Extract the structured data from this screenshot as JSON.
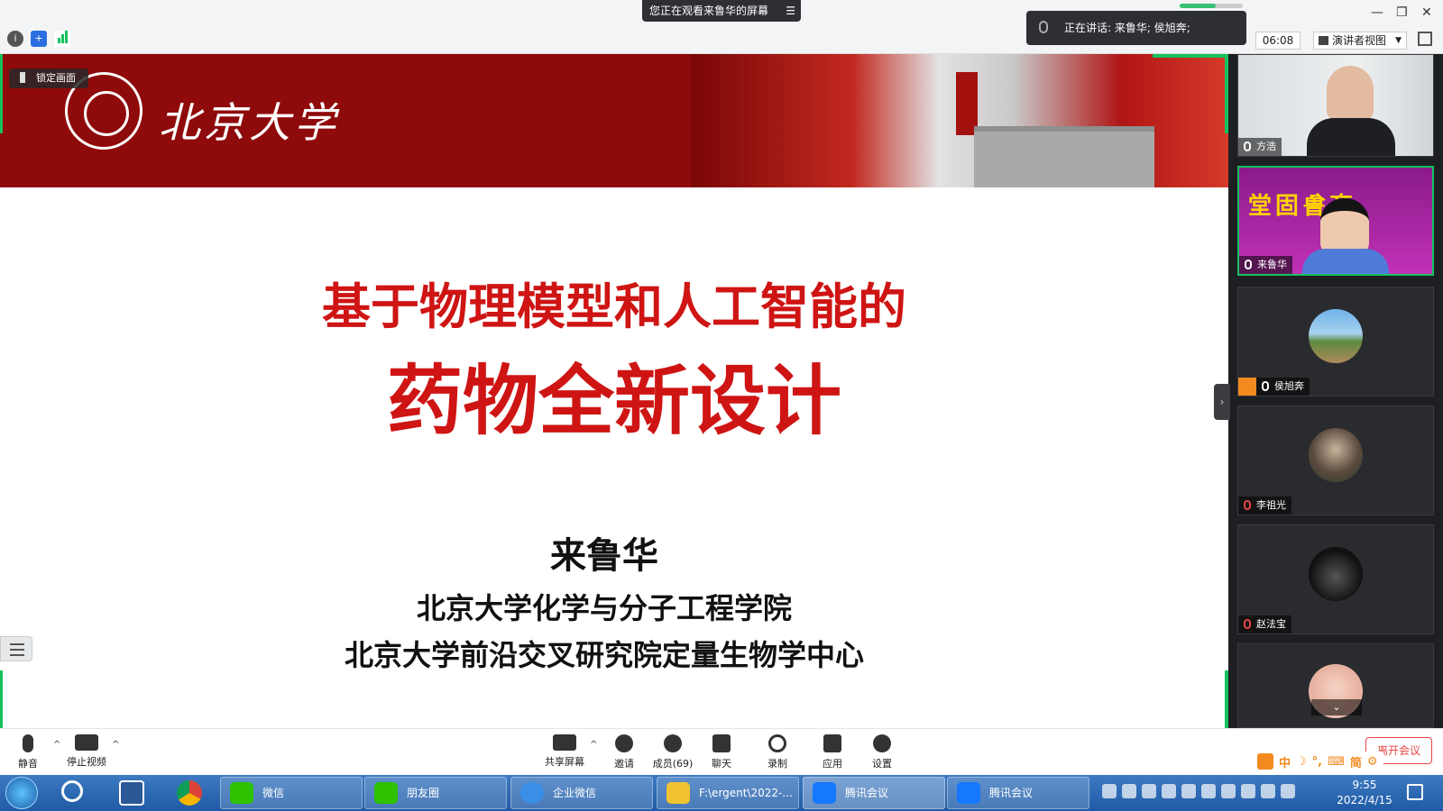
{
  "topbar": {
    "sharing_banner": "您正在观看来鲁华的屏幕",
    "speaking_label": "正在讲话: 来鲁华; 侯旭奔;",
    "timer": "06:08",
    "presenter_view": "演讲者视图",
    "window_minimize": "—",
    "window_restore": "❐",
    "window_close": "✕"
  },
  "slide": {
    "university_name": "北京大学",
    "lock_screen": "锁定画面",
    "title_line1": "基于物理模型和人工智能的",
    "title_line2": "药物全新设计",
    "author": "来鲁华",
    "affiliation_1": "北京大学化学与分子工程学院",
    "affiliation_2": "北京大学前沿交叉研究院定量生物学中心",
    "accent_color": "#cf1414",
    "header_color": "#8f0a0a"
  },
  "participants": [
    {
      "name": "方浩",
      "mic": "on",
      "kind": "video"
    },
    {
      "name": "来鲁华",
      "mic": "on",
      "kind": "video",
      "active": true
    },
    {
      "name": "侯旭奔",
      "mic": "on",
      "kind": "avatar",
      "host": true
    },
    {
      "name": "李祖光",
      "mic": "muted",
      "kind": "avatar"
    },
    {
      "name": "赵法宝",
      "mic": "muted",
      "kind": "avatar"
    },
    {
      "name": "",
      "mic": "on",
      "kind": "avatar"
    }
  ],
  "toolbar": {
    "mute": "静音",
    "stop_video": "停止视频",
    "share_screen": "共享屏幕",
    "invite": "邀请",
    "members": "成员(69)",
    "chat": "聊天",
    "record": "录制",
    "apps": "应用",
    "settings": "设置",
    "end_meeting": "离开会议"
  },
  "ime": {
    "items": [
      "中",
      "简"
    ]
  },
  "taskbar": {
    "tasks": [
      "微信",
      "朋友圈",
      "企业微信",
      "F:\\ergent\\2022-...",
      "腾讯会议",
      "腾讯会议"
    ],
    "time": "9:55",
    "date": "2022/4/15"
  }
}
